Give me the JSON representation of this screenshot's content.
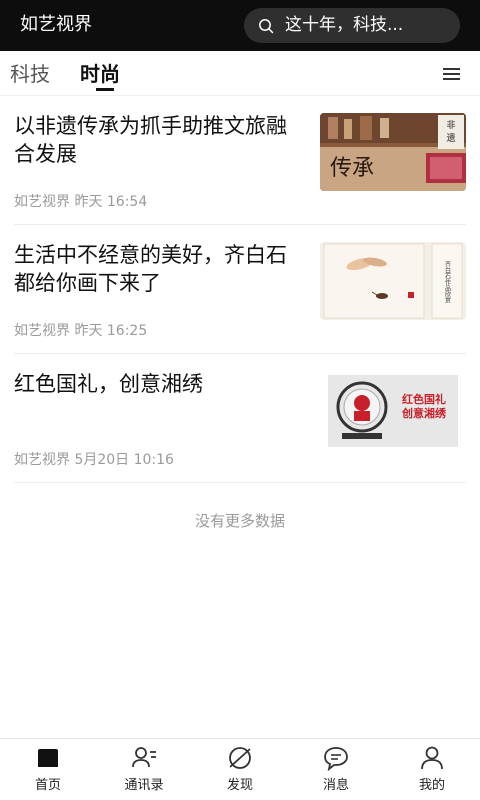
{
  "app": {
    "title": "如艺视界"
  },
  "search": {
    "text": "这十年，科技..."
  },
  "tabs": [
    {
      "label": "科技",
      "active": false
    },
    {
      "label": "时尚",
      "active": true
    }
  ],
  "articles": [
    {
      "title": "以非遗传承为抓手助推文旅融合发展",
      "meta": "如艺视界 昨天 16:54",
      "thumb_text": "传承",
      "thumb_badge": "非遗"
    },
    {
      "title": "生活中不经意的美好，齐白石都给你画下来了",
      "meta": "如艺视界 昨天 16:25",
      "thumb_text": "齐白石作品欣赏"
    },
    {
      "title": "红色国礼，创意湘绣",
      "meta": "如艺视界 5月20日 10:16",
      "thumb_text_1": "红色国礼",
      "thumb_text_2": "创意湘绣"
    }
  ],
  "list_footer": "没有更多数据",
  "bottom_nav": [
    {
      "label": "首页",
      "icon": "home-icon"
    },
    {
      "label": "通讯录",
      "icon": "contacts-icon"
    },
    {
      "label": "发现",
      "icon": "discover-icon"
    },
    {
      "label": "消息",
      "icon": "message-icon"
    },
    {
      "label": "我的",
      "icon": "profile-icon"
    }
  ],
  "colors": {
    "topbar": "#0d0d0d",
    "search_bg": "#2f2f2f",
    "meta_text": "#9a9a9a",
    "accent_red": "#c8202a"
  }
}
